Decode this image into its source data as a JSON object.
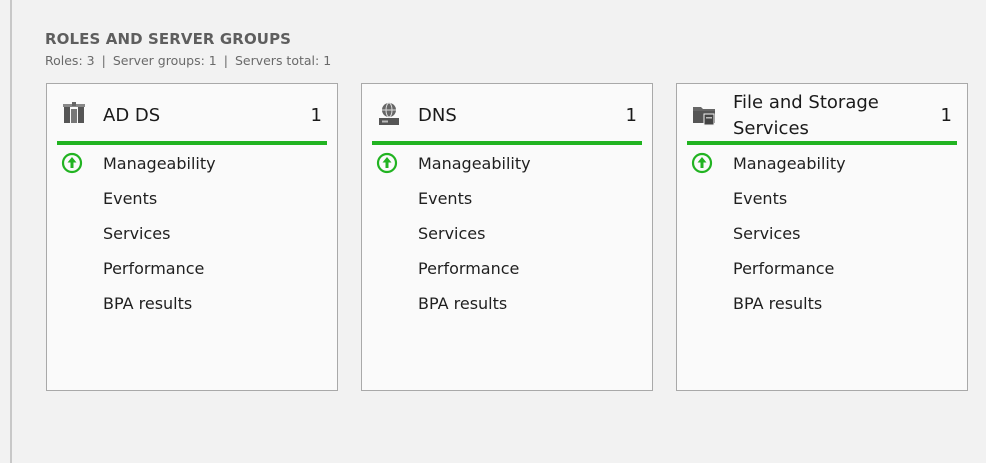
{
  "section": {
    "title": "ROLES AND SERVER GROUPS",
    "roles_text": "Roles: 3",
    "groups_text": "Server groups: 1",
    "servers_text": "Servers total: 1",
    "separator": "|"
  },
  "colors": {
    "status_ok": "#21b321",
    "tile_border": "#a9a9a9"
  },
  "tiles": [
    {
      "title": "AD DS",
      "count": "1",
      "icon": "ad-ds-icon",
      "rows": [
        "Manageability",
        "Events",
        "Services",
        "Performance",
        "BPA results"
      ],
      "manageability_status": "ok-up-arrow-icon"
    },
    {
      "title": "DNS",
      "count": "1",
      "icon": "dns-icon",
      "rows": [
        "Manageability",
        "Events",
        "Services",
        "Performance",
        "BPA results"
      ],
      "manageability_status": "ok-up-arrow-icon"
    },
    {
      "title_line1": "File and Storage",
      "title_line2": "Services",
      "count": "1",
      "icon": "file-storage-icon",
      "rows": [
        "Manageability",
        "Events",
        "Services",
        "Performance",
        "BPA results"
      ],
      "manageability_status": "ok-up-arrow-icon"
    }
  ]
}
